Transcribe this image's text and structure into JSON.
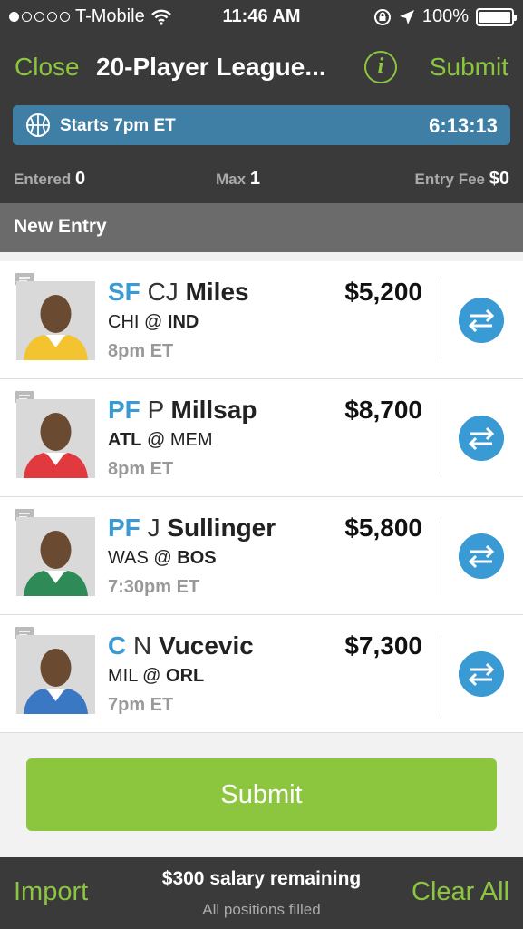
{
  "status_bar": {
    "carrier": "T-Mobile",
    "time": "11:46 AM",
    "battery": "100%",
    "signal_bars": 1
  },
  "nav": {
    "close_label": "Close",
    "title": "20-Player League...",
    "info_label": "i",
    "submit_label": "Submit"
  },
  "contest": {
    "starts": "Starts 7pm ET",
    "countdown": "6:13:13"
  },
  "stats": {
    "entered_label": "Entered",
    "entered_value": "0",
    "max_label": "Max",
    "max_value": "1",
    "fee_label": "Entry Fee",
    "fee_value": "$0"
  },
  "section_title": "New Entry",
  "players": [
    {
      "pos": "SF",
      "initial": "CJ",
      "last": "Miles",
      "salary": "$5,200",
      "away": "CHI",
      "at": "@",
      "home": "IND",
      "bold_team": "home",
      "time": "8pm ET",
      "jersey_color": "#f4c430"
    },
    {
      "pos": "PF",
      "initial": "P",
      "last": "Millsap",
      "salary": "$8,700",
      "away": "ATL",
      "at": "@",
      "home": "MEM",
      "bold_team": "away",
      "time": "8pm ET",
      "jersey_color": "#e03a3e"
    },
    {
      "pos": "PF",
      "initial": "J",
      "last": "Sullinger",
      "salary": "$5,800",
      "away": "WAS",
      "at": "@",
      "home": "BOS",
      "bold_team": "home",
      "time": "7:30pm ET",
      "jersey_color": "#2e8b57"
    },
    {
      "pos": "C",
      "initial": "N",
      "last": "Vucevic",
      "salary": "$7,300",
      "away": "MIL",
      "at": "@",
      "home": "ORL",
      "bold_team": "home",
      "time": "7pm ET",
      "jersey_color": "#3a78c3"
    }
  ],
  "submit_button": "Submit",
  "footer": {
    "import_label": "Import",
    "salary_remaining": "$300 salary remaining",
    "positions_status": "All positions filled",
    "clear_label": "Clear All"
  },
  "colors": {
    "accent_green": "#8cc63f",
    "accent_blue": "#3a9ad4",
    "header_bg": "#3a3a3a",
    "timer_bar": "#3f7fa6"
  }
}
